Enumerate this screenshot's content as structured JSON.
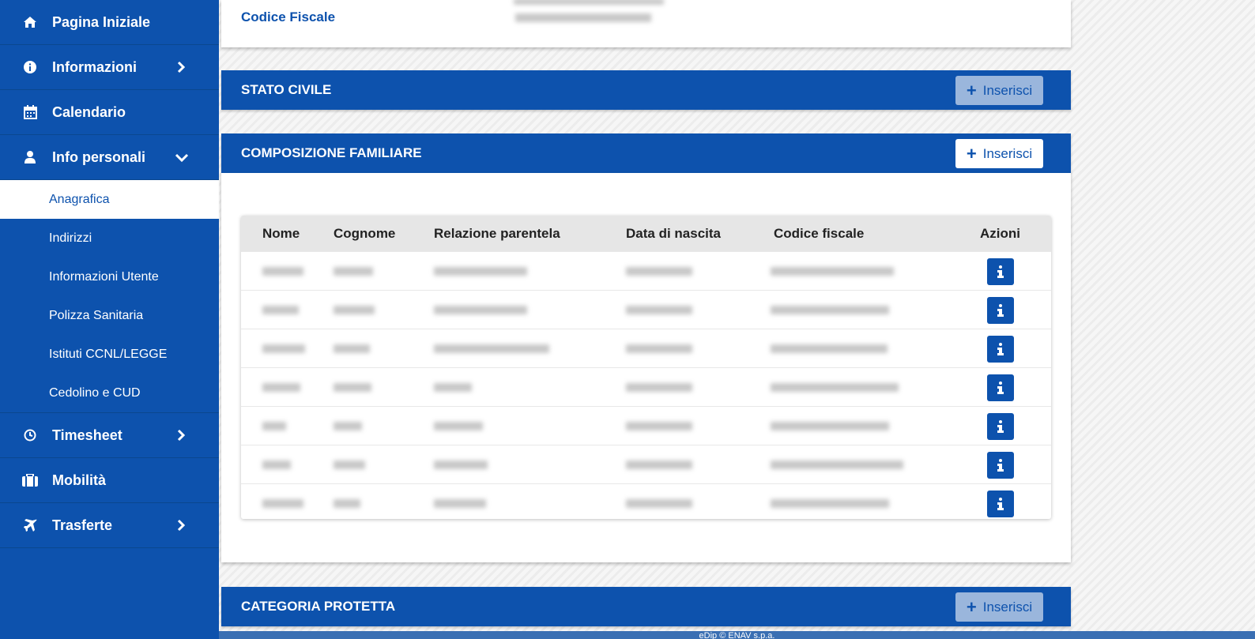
{
  "sidebar": {
    "items": [
      {
        "label": "Pagina Iniziale"
      },
      {
        "label": "Informazioni"
      },
      {
        "label": "Calendario"
      },
      {
        "label": "Info personali"
      },
      {
        "label": "Timesheet"
      },
      {
        "label": "Mobilità"
      },
      {
        "label": "Trasferte"
      }
    ],
    "subitems": [
      {
        "label": "Anagrafica"
      },
      {
        "label": "Indirizzi"
      },
      {
        "label": "Informazioni Utente"
      },
      {
        "label": "Polizza Sanitaria"
      },
      {
        "label": "Istituti CCNL/LEGGE"
      },
      {
        "label": "Cedolino e CUD"
      }
    ]
  },
  "personal": {
    "codice_fiscale_label": "Codice Fiscale"
  },
  "sections": {
    "stato_civile": {
      "title": "STATO CIVILE",
      "button": "Inserisci"
    },
    "composizione": {
      "title": "COMPOSIZIONE FAMILIARE",
      "button": "Inserisci"
    },
    "categoria": {
      "title": "CATEGORIA PROTETTA",
      "button": "Inserisci"
    }
  },
  "family_table": {
    "headers": {
      "nome": "Nome",
      "cognome": "Cognome",
      "relazione": "Relazione parentela",
      "data": "Data di nascita",
      "cf": "Codice fiscale",
      "azioni": "Azioni"
    }
  },
  "footer": {
    "text": "eDip © ENAV s.p.a."
  },
  "colors": {
    "primary": "#0d52ad",
    "white": "#ffffff"
  }
}
